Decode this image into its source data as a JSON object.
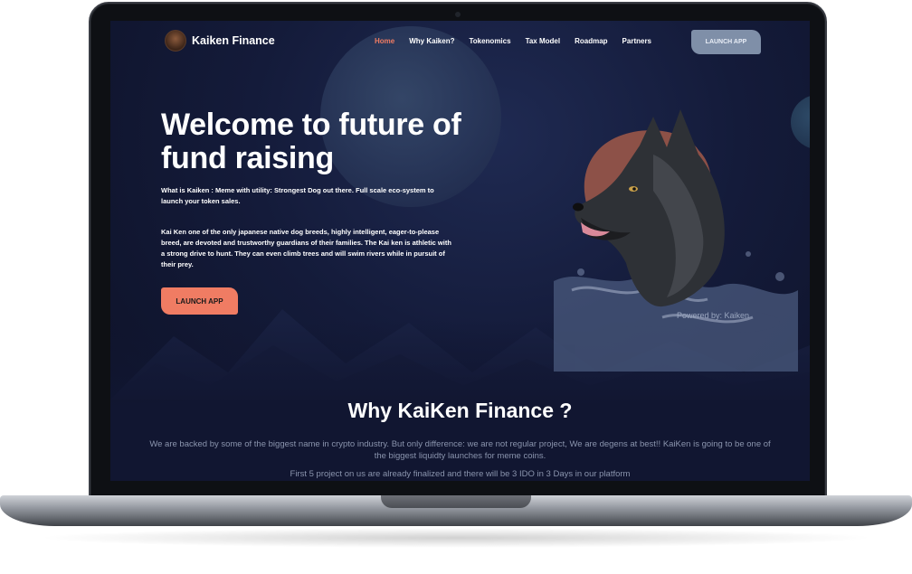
{
  "brand": {
    "name": "Kaiken Finance",
    "logo_icon": "dog-head-icon"
  },
  "nav": {
    "items": [
      {
        "label": "Home",
        "active": true
      },
      {
        "label": "Why Kaiken?",
        "active": false
      },
      {
        "label": "Tokenomics",
        "active": false
      },
      {
        "label": "Tax Model",
        "active": false
      },
      {
        "label": "Roadmap",
        "active": false
      },
      {
        "label": "Partners",
        "active": false
      }
    ],
    "launch_label": "LAUNCH APP"
  },
  "hero": {
    "title": "Welcome to future of fund raising",
    "subtitle": "What is Kaiken : Meme with utility: Strongest Dog out there. Full scale eco-system to launch your token sales.",
    "description": "Kai Ken one of the only japanese native dog breeds, highly intelligent, eager-to-please breed, are devoted and trustworthy guardians of their families. The Kai ken is athletic with a strong drive to hunt. They can even climb trees and will swim rivers while in pursuit of their prey.",
    "launch_label": "LAUNCH APP",
    "powered_by": "Powered by: Kaiken",
    "illustration_icon": "kai-ken-dog-illustration"
  },
  "why": {
    "title": "Why KaiKen Finance ?",
    "text": "We are backed by some of the biggest name in crypto industry. But only difference: we are not regular project, We are degens at best!! KaiKen is going to be one of the biggest liquidty launches for meme coins.",
    "text2": "First 5 project on us are already finalized and there will be 3 IDO in 3 Days in our platform"
  },
  "colors": {
    "accent": "#f07c63",
    "nav_button": "#7f8fa8",
    "background": "#141b3a",
    "muted_text": "#8a94ad"
  }
}
